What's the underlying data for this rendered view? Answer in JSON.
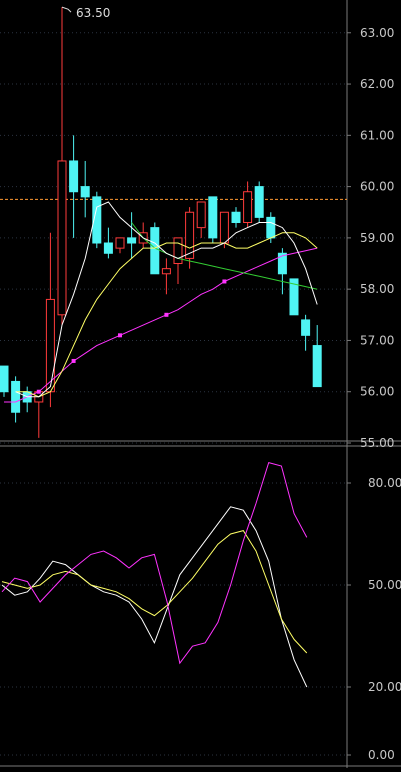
{
  "chart_data": [
    {
      "type": "candlestick",
      "y_range": [
        55.0,
        63.6
      ],
      "yticks": [
        "63.00",
        "62.00",
        "61.00",
        "60.00",
        "59.00",
        "58.00",
        "57.00",
        "56.00",
        "55.00"
      ],
      "ytick_values": [
        63,
        62,
        61,
        60,
        59,
        58,
        57,
        56,
        55
      ],
      "annotation": "63.50",
      "reference_line": 59.75,
      "colors": {
        "up": "#ff3b3b",
        "down": "#4ff4f4",
        "ma5": "#ffffff",
        "ma10": "#ffff66",
        "ma20": "#33cc33",
        "ma60": "#ff33ff",
        "ref": "#ff9933",
        "grid": "#2b3340",
        "axis": "#7a7a7a"
      },
      "candles": [
        {
          "o": 56.5,
          "h": 56.5,
          "l": 55.9,
          "c": 56.0
        },
        {
          "o": 56.2,
          "h": 56.3,
          "l": 55.4,
          "c": 55.6
        },
        {
          "o": 56.0,
          "h": 56.1,
          "l": 55.6,
          "c": 55.8
        },
        {
          "o": 55.8,
          "h": 56.0,
          "l": 55.1,
          "c": 56.0
        },
        {
          "o": 56.0,
          "h": 59.1,
          "l": 55.7,
          "c": 57.8
        },
        {
          "o": 57.5,
          "h": 63.5,
          "l": 57.3,
          "c": 60.5
        },
        {
          "o": 60.5,
          "h": 61.0,
          "l": 59.0,
          "c": 59.9
        },
        {
          "o": 60.0,
          "h": 60.5,
          "l": 59.4,
          "c": 59.8
        },
        {
          "o": 59.8,
          "h": 59.9,
          "l": 58.8,
          "c": 58.9
        },
        {
          "o": 58.9,
          "h": 59.2,
          "l": 58.6,
          "c": 58.7
        },
        {
          "o": 58.8,
          "h": 59.0,
          "l": 58.7,
          "c": 59.0
        },
        {
          "o": 59.0,
          "h": 59.5,
          "l": 58.6,
          "c": 58.9
        },
        {
          "o": 58.9,
          "h": 59.3,
          "l": 58.8,
          "c": 59.1
        },
        {
          "o": 59.2,
          "h": 59.3,
          "l": 58.3,
          "c": 58.3
        },
        {
          "o": 58.3,
          "h": 58.6,
          "l": 57.9,
          "c": 58.4
        },
        {
          "o": 58.5,
          "h": 59.0,
          "l": 58.1,
          "c": 59.0
        },
        {
          "o": 58.6,
          "h": 59.6,
          "l": 58.4,
          "c": 59.5
        },
        {
          "o": 59.2,
          "h": 59.6,
          "l": 59.0,
          "c": 59.7
        },
        {
          "o": 59.8,
          "h": 59.8,
          "l": 58.9,
          "c": 59.0
        },
        {
          "o": 58.9,
          "h": 59.3,
          "l": 58.8,
          "c": 59.5
        },
        {
          "o": 59.5,
          "h": 59.6,
          "l": 59.2,
          "c": 59.3
        },
        {
          "o": 59.3,
          "h": 60.1,
          "l": 59.2,
          "c": 59.9
        },
        {
          "o": 60.0,
          "h": 60.1,
          "l": 59.3,
          "c": 59.4
        },
        {
          "o": 59.4,
          "h": 59.5,
          "l": 58.9,
          "c": 59.0
        },
        {
          "o": 58.7,
          "h": 58.8,
          "l": 57.9,
          "c": 58.3
        },
        {
          "o": 58.2,
          "h": 58.2,
          "l": 57.5,
          "c": 57.5
        },
        {
          "o": 57.4,
          "h": 57.5,
          "l": 56.8,
          "c": 57.1
        },
        {
          "o": 56.9,
          "h": 57.3,
          "l": 56.1,
          "c": 56.1
        }
      ],
      "ma5": [
        null,
        56.0,
        55.9,
        55.9,
        56.1,
        57.3,
        57.9,
        58.6,
        59.6,
        59.7,
        59.4,
        59.2,
        59.0,
        58.9,
        58.7,
        58.6,
        58.7,
        58.8,
        58.8,
        58.9,
        59.1,
        59.2,
        59.3,
        59.3,
        59.2,
        58.9,
        58.4,
        57.7
      ],
      "ma10": [
        null,
        56.0,
        56.0,
        55.9,
        56.0,
        56.4,
        56.9,
        57.4,
        57.8,
        58.1,
        58.4,
        58.6,
        58.8,
        58.8,
        58.9,
        58.9,
        58.8,
        58.9,
        58.9,
        58.9,
        58.8,
        58.8,
        58.9,
        59.0,
        59.1,
        59.1,
        59.0,
        58.8
      ],
      "ma20": [
        null,
        null,
        null,
        null,
        null,
        null,
        null,
        null,
        null,
        null,
        null,
        59.3,
        59.0,
        58.8,
        58.7,
        58.6,
        58.55,
        58.5,
        58.45,
        58.4,
        58.35,
        58.3,
        58.25,
        58.2,
        58.15,
        58.1,
        58.05,
        58.0
      ],
      "ma60": [
        55.8,
        55.8,
        55.9,
        56.0,
        56.2,
        56.4,
        56.6,
        56.75,
        56.9,
        57.0,
        57.1,
        57.2,
        57.3,
        57.4,
        57.5,
        57.6,
        57.75,
        57.9,
        58.0,
        58.15,
        58.25,
        58.35,
        58.45,
        58.55,
        58.65,
        58.7,
        58.75,
        58.8
      ]
    },
    {
      "type": "line",
      "y_range": [
        0,
        90
      ],
      "yticks": [
        "80.00",
        "50.00",
        "20.00",
        "0.00"
      ],
      "ytick_values": [
        80,
        50,
        20,
        0
      ],
      "series": [
        {
          "color": "#ffffff",
          "values": [
            50,
            47,
            48,
            52,
            57,
            56,
            53,
            50,
            48,
            47,
            45,
            40,
            33,
            43,
            53,
            58,
            63,
            68,
            73,
            72,
            66,
            57,
            40,
            28,
            20
          ]
        },
        {
          "color": "#ffff66",
          "values": [
            51,
            50,
            49,
            50,
            53,
            54,
            53,
            50,
            49,
            48,
            46,
            43,
            41,
            44,
            48,
            52,
            57,
            62,
            65,
            66,
            60,
            50,
            40,
            34,
            30
          ]
        },
        {
          "color": "#ff33ff",
          "values": [
            48,
            52,
            51,
            45,
            49,
            53,
            56,
            59,
            60,
            58,
            55,
            58,
            59,
            45,
            27,
            32,
            33,
            39,
            50,
            63,
            74,
            86,
            85,
            71,
            64
          ]
        }
      ]
    }
  ]
}
